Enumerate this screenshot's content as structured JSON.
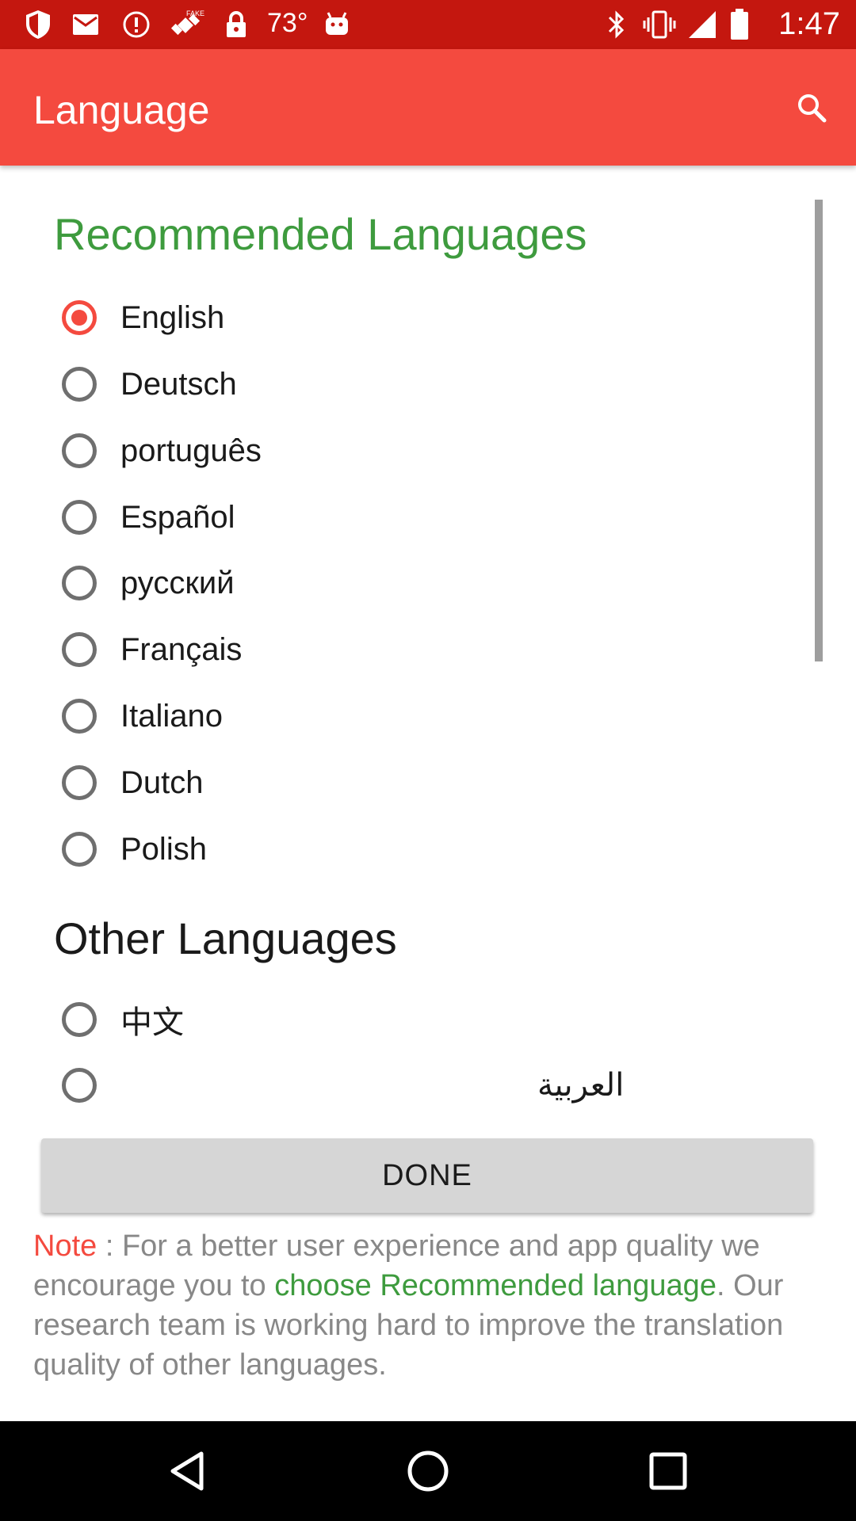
{
  "status_bar": {
    "temperature": "73°",
    "time": "1:47",
    "icons": [
      "shield-icon",
      "mail-icon",
      "alert-icon",
      "satellite-fake-icon",
      "lock-icon",
      "android-icon",
      "bluetooth-icon",
      "vibrate-icon",
      "signal-icon",
      "battery-icon"
    ]
  },
  "app_bar": {
    "title": "Language",
    "search_icon": "search-icon"
  },
  "colors": {
    "status_bar": "#c4170f",
    "app_bar": "#f44a3f",
    "accent_green": "#3e9b3e",
    "accent_red": "#f44a3f"
  },
  "recommended": {
    "title": "Recommended Languages",
    "options": [
      {
        "label": "English",
        "checked": true
      },
      {
        "label": "Deutsch",
        "checked": false
      },
      {
        "label": "português",
        "checked": false
      },
      {
        "label": "Español",
        "checked": false
      },
      {
        "label": "русский",
        "checked": false
      },
      {
        "label": "Français",
        "checked": false
      },
      {
        "label": "Italiano",
        "checked": false
      },
      {
        "label": "Dutch",
        "checked": false
      },
      {
        "label": "Polish",
        "checked": false
      }
    ]
  },
  "other": {
    "title": "Other Languages",
    "options": [
      {
        "label": "中文",
        "checked": false
      },
      {
        "label": "العربية",
        "checked": false
      }
    ]
  },
  "done_button": "DONE",
  "note": {
    "label": "Note",
    "text1": " : For a better user experience and app quality we encourage you to ",
    "link": "choose Recommended language",
    "text2": ". Our research team is working hard to improve the translation quality of other languages."
  },
  "nav_bar": {
    "back_icon": "back-icon",
    "home_icon": "home-icon",
    "recents_icon": "recents-icon"
  }
}
